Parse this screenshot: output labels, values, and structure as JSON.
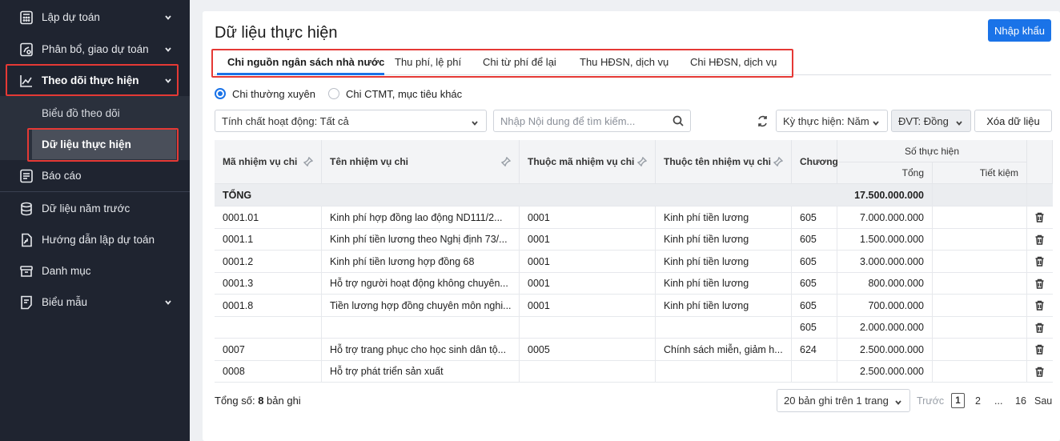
{
  "sidebar": {
    "items": [
      {
        "label": "Lập dự toán",
        "icon": "calculator-icon",
        "chevron": true
      },
      {
        "label": "Phân bổ, giao dự toán",
        "icon": "allocation-icon",
        "chevron": true
      },
      {
        "label": "Theo dõi thực hiện",
        "icon": "chart-line-icon",
        "chevron": true,
        "active": true
      },
      {
        "label": "Báo cáo",
        "icon": "report-icon",
        "chevron": false
      },
      {
        "label": "Dữ liệu năm trước",
        "icon": "database-icon",
        "chevron": false
      },
      {
        "label": "Hướng dẫn lập dự toán",
        "icon": "guide-icon",
        "chevron": false
      },
      {
        "label": "Danh mục",
        "icon": "archive-icon",
        "chevron": false
      },
      {
        "label": "Biểu mẫu",
        "icon": "form-icon",
        "chevron": true
      }
    ],
    "submenu": [
      {
        "label": "Biểu đồ theo dõi"
      },
      {
        "label": "Dữ liệu thực hiện",
        "selected": true
      }
    ],
    "highlight_color": "#e53935"
  },
  "main": {
    "title": "Dữ liệu thực hiện",
    "import_button": "Nhập khẩu",
    "tabs": [
      {
        "label": "Chi nguồn ngân sách nhà nước",
        "active": true
      },
      {
        "label": "Thu phí, lệ phí"
      },
      {
        "label": "Chi từ phí để lại"
      },
      {
        "label": "Thu HĐSN, dịch vụ"
      },
      {
        "label": "Chi HĐSN, dịch vụ"
      }
    ],
    "radios": [
      {
        "label": "Chi thường xuyên",
        "checked": true
      },
      {
        "label": "Chi CTMT, mục tiêu khác",
        "checked": false
      }
    ],
    "filters": {
      "activity_nature": "Tính chất hoạt động: Tất cả",
      "search_placeholder": "Nhập Nội dung để tìm kiếm...",
      "period": "Kỳ thực hiện: Năm",
      "unit": "ĐVT: Đồng",
      "clear_button": "Xóa dữ liệu"
    },
    "table": {
      "headers": {
        "code": "Mã nhiệm vụ chi",
        "name": "Tên nhiệm vụ chi",
        "parent_code": "Thuộc mã nhiệm vụ chi",
        "parent_name": "Thuộc tên nhiệm vụ chi",
        "chapter": "Chương",
        "actual_group": "Số thực hiện",
        "total": "Tổng",
        "savings": "Tiết kiệm"
      },
      "total_row": {
        "label": "TỔNG",
        "total": "17.500.000.000"
      },
      "rows": [
        {
          "code": "0001.01",
          "name": "Kinh phí hợp đồng lao động ND111/2...",
          "parent_code": "0001",
          "parent_name": "Kinh phí tiền lương",
          "chapter": "605",
          "total": "7.000.000.000",
          "savings": ""
        },
        {
          "code": "0001.1",
          "name": "Kinh phí tiền lương theo Nghị định 73/...",
          "parent_code": "0001",
          "parent_name": "Kinh phí tiền lương",
          "chapter": "605",
          "total": "1.500.000.000",
          "savings": ""
        },
        {
          "code": "0001.2",
          "name": "Kinh phí tiền lương hợp đồng 68",
          "parent_code": "0001",
          "parent_name": "Kinh phí tiền lương",
          "chapter": "605",
          "total": "3.000.000.000",
          "savings": ""
        },
        {
          "code": "0001.3",
          "name": "Hỗ trợ người hoạt động không chuyên...",
          "parent_code": "0001",
          "parent_name": "Kinh phí tiền lương",
          "chapter": "605",
          "total": "800.000.000",
          "savings": ""
        },
        {
          "code": "0001.8",
          "name": "Tiền lương hợp đồng chuyên môn nghi...",
          "parent_code": "0001",
          "parent_name": "Kinh phí tiền lương",
          "chapter": "605",
          "total": "700.000.000",
          "savings": ""
        },
        {
          "code": "",
          "name": "",
          "parent_code": "",
          "parent_name": "",
          "chapter": "605",
          "total": "2.000.000.000",
          "savings": ""
        },
        {
          "code": "0007",
          "name": "Hỗ trợ trang phục cho học sinh dân tộ...",
          "parent_code": "0005",
          "parent_name": "Chính sách miễn, giảm h...",
          "chapter": "624",
          "total": "2.500.000.000",
          "savings": ""
        },
        {
          "code": "0008",
          "name": "Hỗ trợ phát triển sản xuất",
          "parent_code": "",
          "parent_name": "",
          "chapter": "",
          "total": "2.500.000.000",
          "savings": ""
        }
      ]
    },
    "footer": {
      "total_prefix": "Tổng số: ",
      "total_count": "8",
      "total_suffix": " bản ghi",
      "page_size": "20 bản ghi trên 1 trang",
      "prev": "Trước",
      "pages": [
        "1",
        "2",
        "...",
        "16"
      ],
      "next": "Sau"
    }
  },
  "colors": {
    "accent": "#1a73e8",
    "sidebar_bg": "#1f2430",
    "highlight": "#e53935"
  }
}
